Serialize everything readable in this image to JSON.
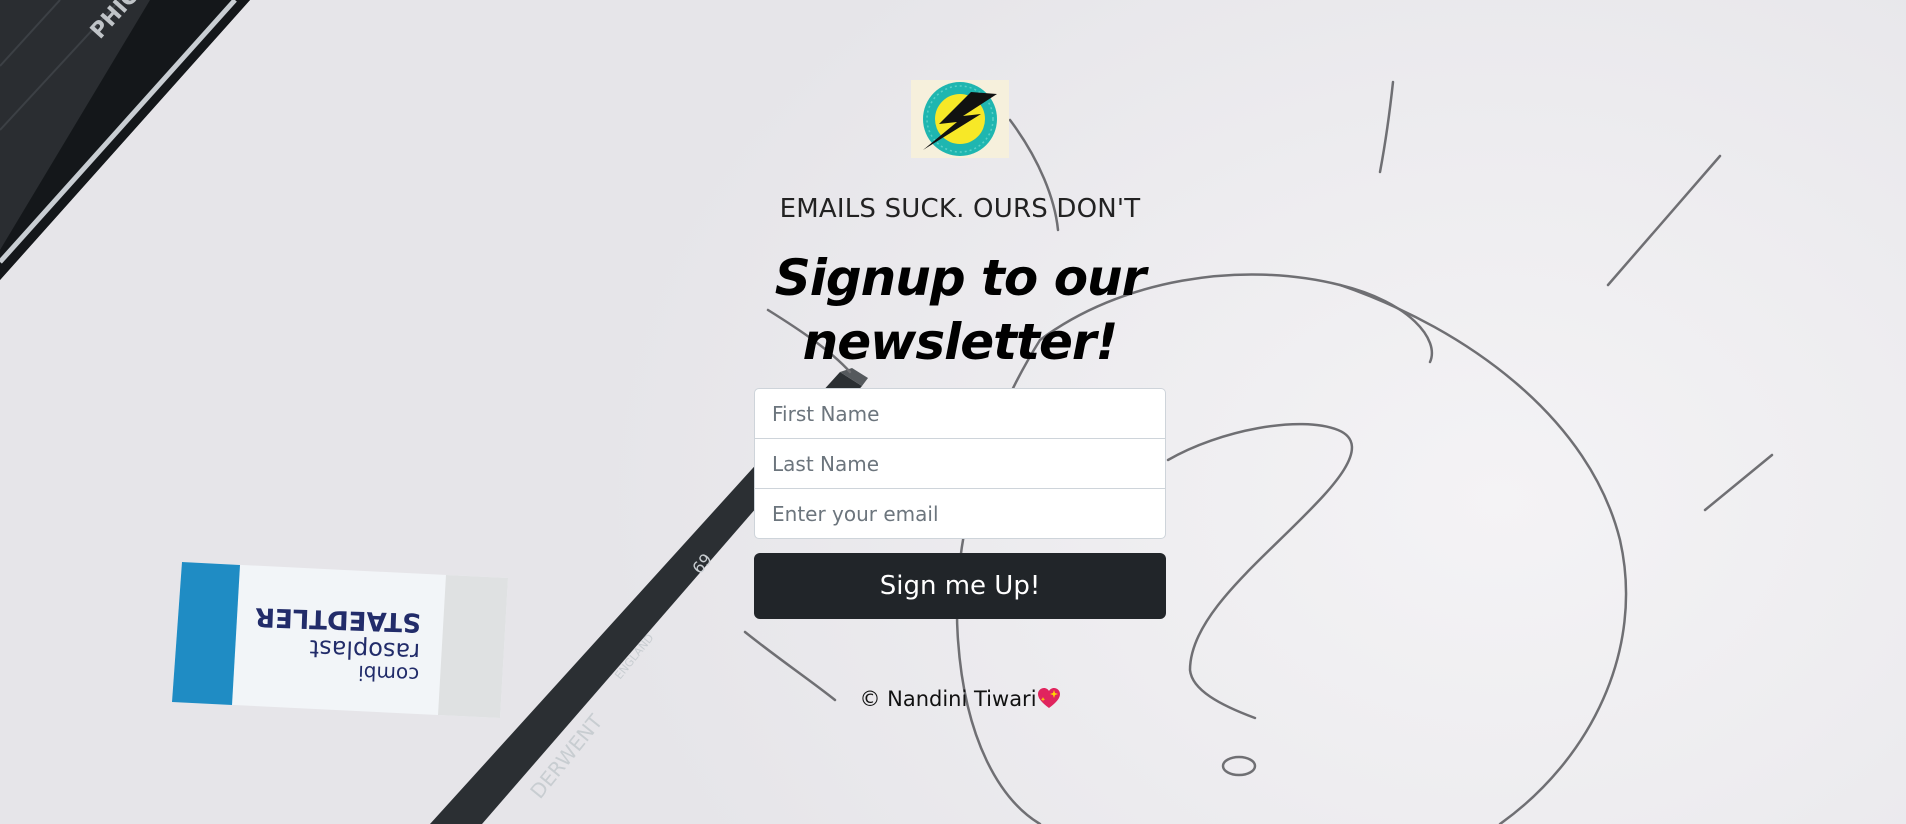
{
  "header": {
    "logo_icon": "lightning-bolt-icon",
    "tagline": "EMAILS SUCK. OURS DON'T"
  },
  "main": {
    "headline": "Signup to our newsletter!"
  },
  "form": {
    "first_name": {
      "placeholder": "First Name",
      "value": ""
    },
    "last_name": {
      "placeholder": "Last Name",
      "value": ""
    },
    "email": {
      "placeholder": "Enter your email",
      "value": ""
    },
    "submit_label": "Sign me Up!"
  },
  "footer": {
    "copyright": "© Nandini Tiwari",
    "heart_icon": "sparkling-heart-icon"
  },
  "colors": {
    "button_bg": "#212529",
    "button_text": "#ffffff",
    "logo_teal": "#1fb6b0",
    "logo_yellow": "#f7e827"
  }
}
